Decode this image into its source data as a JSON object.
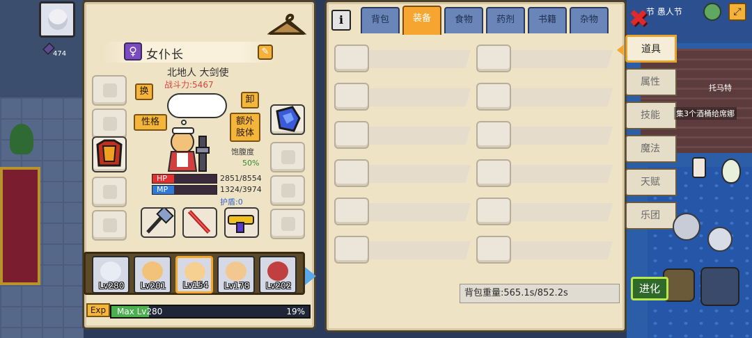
{
  "character": {
    "name": "女仆长",
    "gender_symbol": "♀",
    "origin_class": "北地人 大剑使",
    "power": "战斗力:5467",
    "satiety_label": "饱腹度",
    "satiety_value": "50%",
    "hp_label": "HP",
    "hp_value": "2851/8554",
    "hp_fraction": 0.333,
    "mp_label": "MP",
    "mp_value": "1324/3974",
    "mp_fraction": 0.333,
    "shield": "护盾:0"
  },
  "buttons": {
    "swap": "换",
    "unequip": "卸",
    "personality": "性格",
    "extra_limb": "额外\n肢体",
    "evolve": "进化"
  },
  "party": [
    {
      "level": "Lv280",
      "face_color": "#e8ecf4"
    },
    {
      "level": "Lv201",
      "face_color": "#f2c27a"
    },
    {
      "level": "Lv154",
      "face_color": "#f5d090",
      "selected": true
    },
    {
      "level": "Lv178",
      "face_color": "#f2c890"
    },
    {
      "level": "Lv202",
      "face_color": "#c04040"
    }
  ],
  "exp": {
    "tag": "Exp",
    "label": "Max Lv280",
    "percent_text": "19%",
    "fraction": 0.19
  },
  "tabs": [
    {
      "label": "背包"
    },
    {
      "label": "装备",
      "active": true
    },
    {
      "label": "食物"
    },
    {
      "label": "药剂"
    },
    {
      "label": "书籍"
    },
    {
      "label": "杂物"
    }
  ],
  "weight": "背包重量:565.1s/852.2s",
  "side_menu": [
    {
      "label": "道具",
      "active": true
    },
    {
      "label": "属性"
    },
    {
      "label": "技能"
    },
    {
      "label": "魔法"
    },
    {
      "label": "天赋"
    },
    {
      "label": "乐团"
    }
  ],
  "world": {
    "top_right_text": "节 愚人节",
    "npc_name": "托马特",
    "quest_text": "集3个酒桶给席娜",
    "hud_level": "474"
  },
  "icons": {
    "info": "i",
    "close": "✖",
    "edit": "✎",
    "expand": "⤢"
  }
}
